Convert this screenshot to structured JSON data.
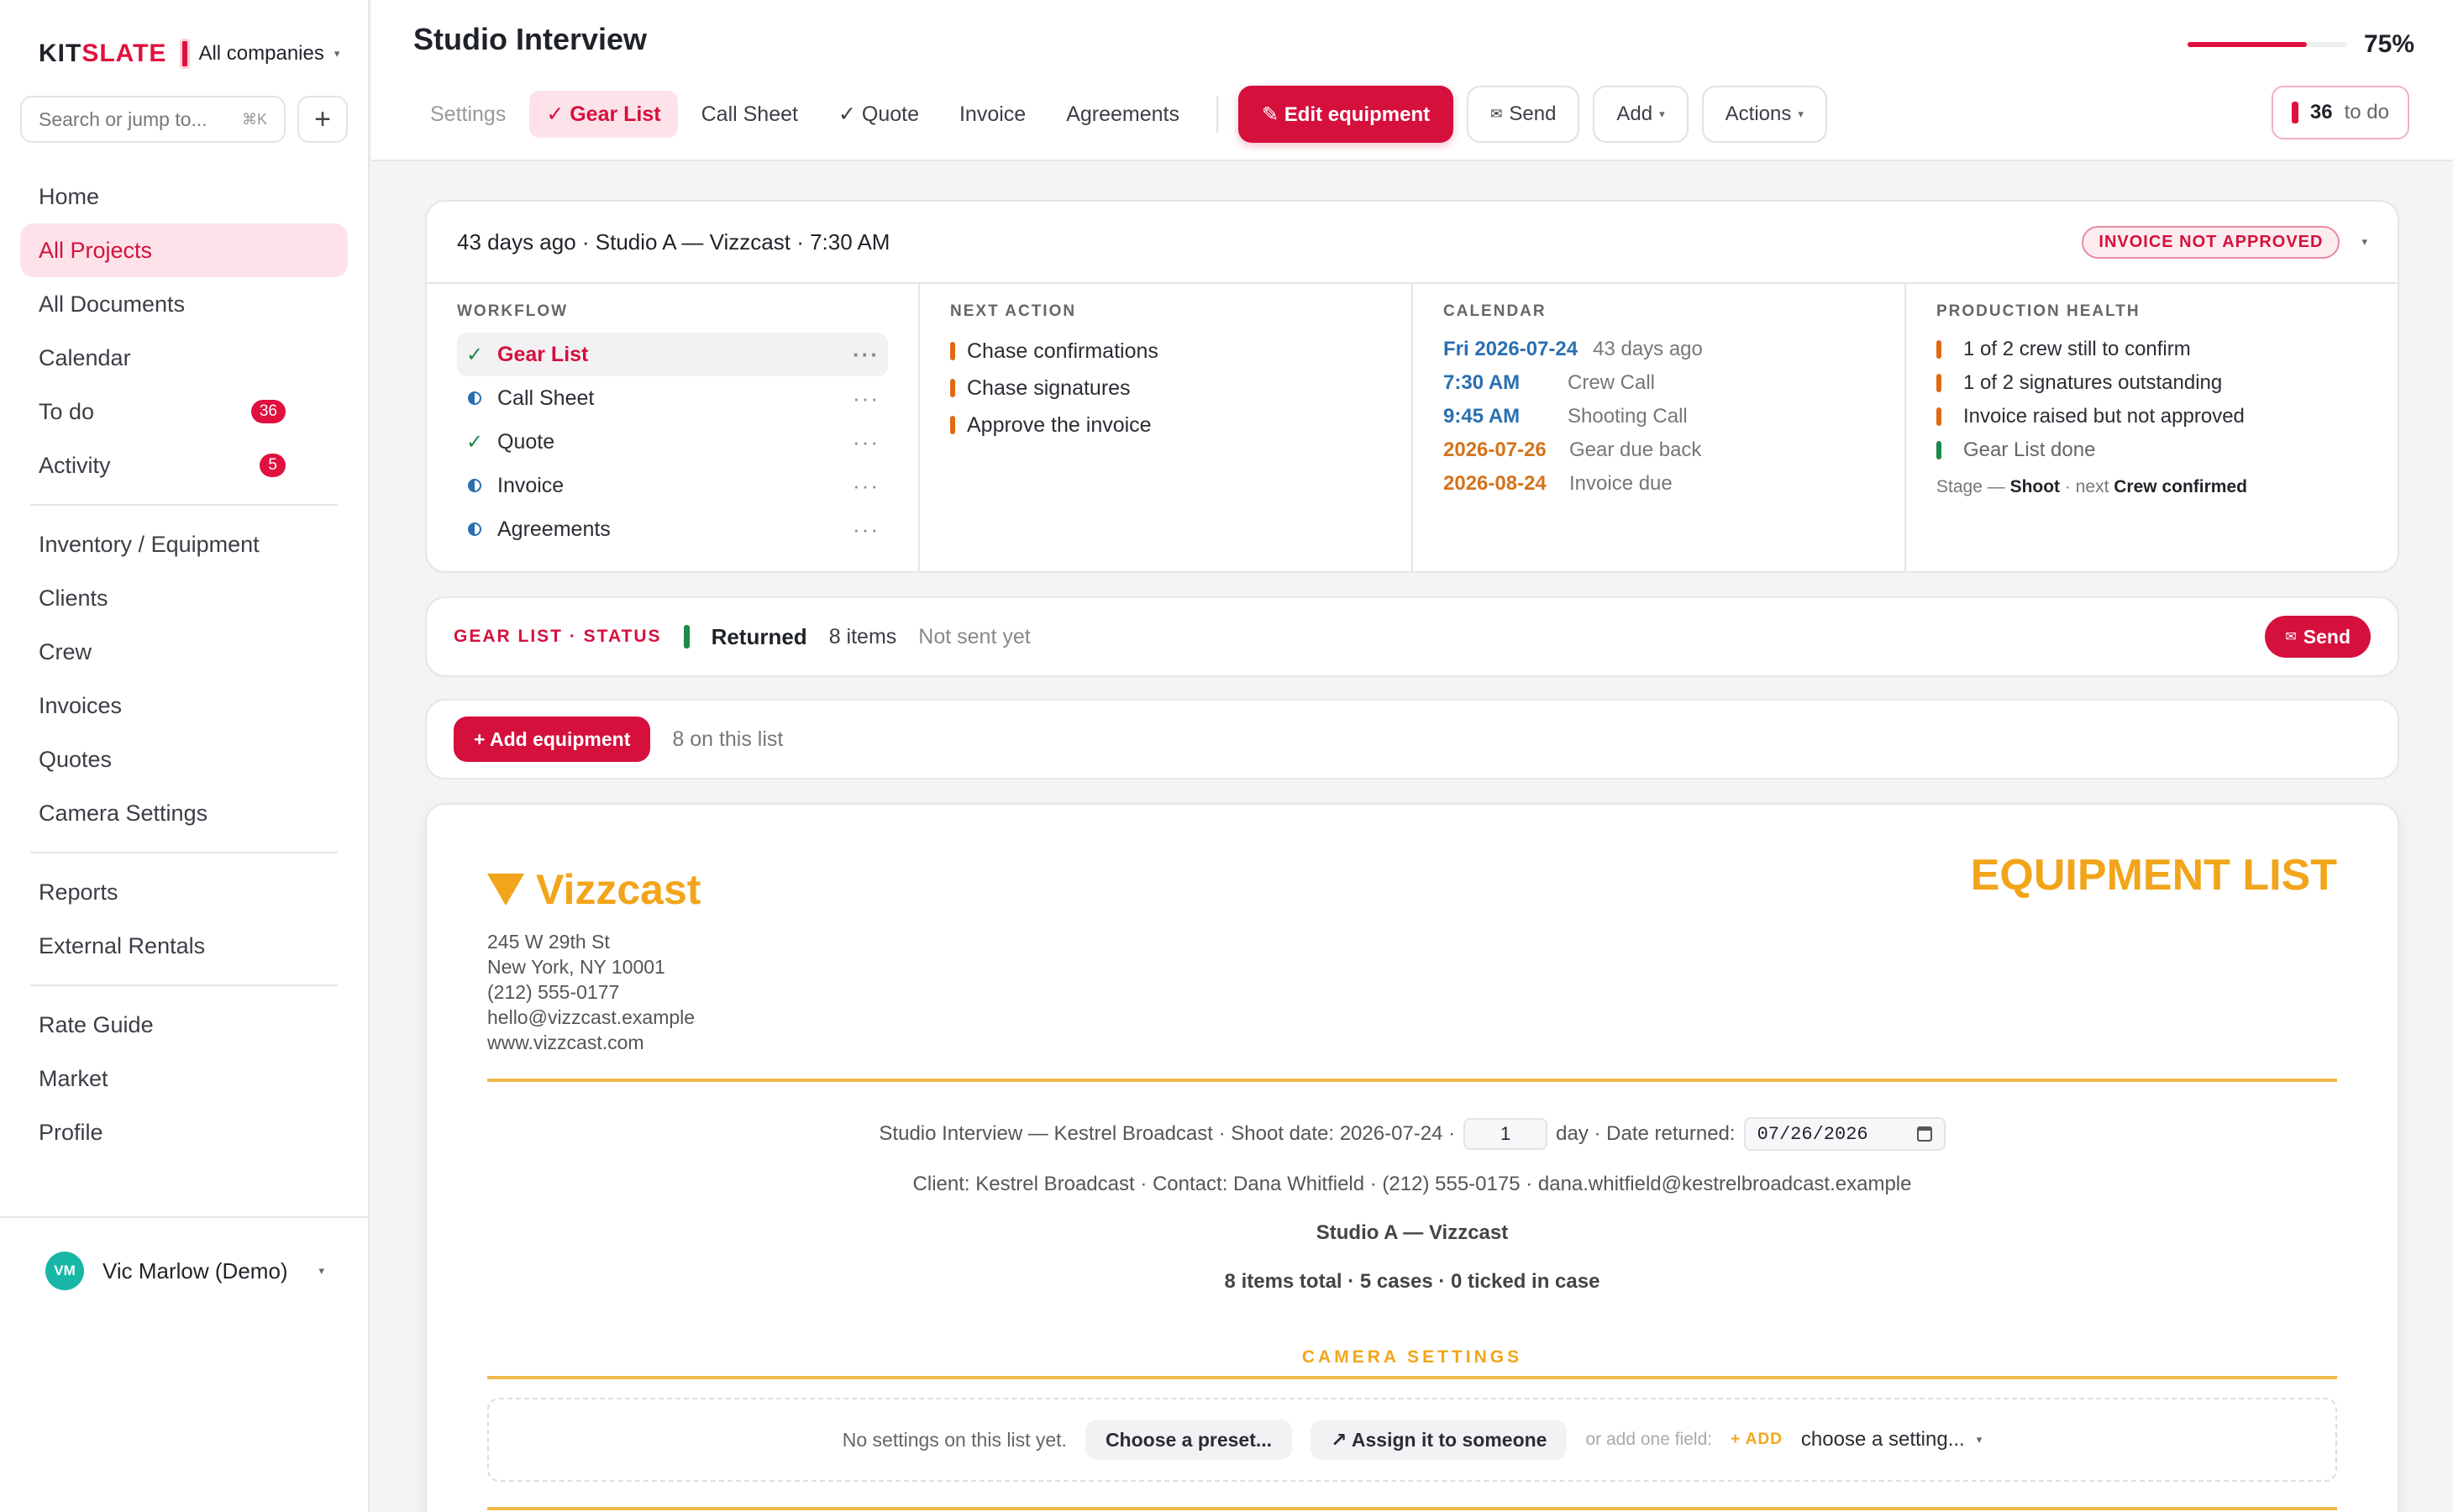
{
  "app": {
    "brand_left": "KIT",
    "brand_right": "SLATE",
    "company": "All companies"
  },
  "search": {
    "placeholder": "Search or jump to...",
    "shortcut": "⌘K"
  },
  "nav": {
    "group1": [
      {
        "label": "Home"
      },
      {
        "label": "All Projects",
        "active": true
      },
      {
        "label": "All Documents"
      },
      {
        "label": "Calendar"
      },
      {
        "label": "To do",
        "badge": "36"
      },
      {
        "label": "Activity",
        "badge": "5"
      }
    ],
    "group2": [
      {
        "label": "Inventory / Equipment"
      },
      {
        "label": "Clients"
      },
      {
        "label": "Crew"
      },
      {
        "label": "Invoices"
      },
      {
        "label": "Quotes"
      },
      {
        "label": "Camera Settings"
      }
    ],
    "group3": [
      {
        "label": "Reports"
      },
      {
        "label": "External Rentals"
      }
    ],
    "group4": [
      {
        "label": "Rate Guide"
      },
      {
        "label": "Market"
      },
      {
        "label": "Profile"
      }
    ]
  },
  "user": {
    "initials": "VM",
    "name": "Vic Marlow (Demo)"
  },
  "header": {
    "title": "Studio Interview",
    "tabs": [
      {
        "label": "Settings"
      },
      {
        "label": "✓ Gear List"
      },
      {
        "label": "Call Sheet"
      },
      {
        "label": "✓ Quote"
      },
      {
        "label": "Invoice"
      },
      {
        "label": "Agreements"
      }
    ],
    "edit_label": "✎ Edit equipment",
    "send_label": "Send",
    "add_label": "Add",
    "actions_label": "Actions",
    "progress_value": 75,
    "progress_text": "75%",
    "todo_count": "36",
    "todo_label": "to do"
  },
  "summary": {
    "title": "43 days ago · Studio A — Vizzcast · 7:30 AM",
    "status_pill": "INVOICE NOT APPROVED",
    "workflow_heading": "WORKFLOW",
    "workflow": [
      {
        "label": "Gear List",
        "state": "done"
      },
      {
        "label": "Call Sheet",
        "state": "partial"
      },
      {
        "label": "Quote",
        "state": "done"
      },
      {
        "label": "Invoice",
        "state": "partial"
      },
      {
        "label": "Agreements",
        "state": "partial"
      }
    ],
    "next_heading": "NEXT ACTION",
    "next_actions": [
      "Chase confirmations",
      "Chase signatures",
      "Approve the invoice"
    ],
    "calendar_heading": "CALENDAR",
    "calendar": [
      {
        "key": "Fri 2026-07-24",
        "value": "43 days ago",
        "tone": "blue"
      },
      {
        "key": "7:30 AM",
        "value": "Crew Call",
        "tone": "blue"
      },
      {
        "key": "9:45 AM",
        "value": "Shooting Call",
        "tone": "blue"
      },
      {
        "key": "2026-07-26",
        "value": "Gear due back",
        "tone": "orange"
      },
      {
        "key": "2026-08-24",
        "value": "Invoice due",
        "tone": "orange"
      }
    ],
    "health_heading": "PRODUCTION HEALTH",
    "health": [
      {
        "label": "1 of 2 crew still to confirm",
        "tone": "orange"
      },
      {
        "label": "1 of 2 signatures outstanding",
        "tone": "orange"
      },
      {
        "label": "Invoice raised but not approved",
        "tone": "orange"
      },
      {
        "label": "Gear List done",
        "tone": "green"
      }
    ],
    "stage_prefix": "Stage —",
    "stage_value": "Shoot",
    "stage_mid": "· next",
    "stage_next": "Crew confirmed"
  },
  "gear_status": {
    "label": "GEAR LIST · STATUS",
    "status": "Returned",
    "items": "8 items",
    "note": "Not sent yet",
    "send_label": "Send"
  },
  "add_bar": {
    "button_label": "+ Add equipment",
    "note": "8 on this list"
  },
  "doc": {
    "brand": "Vizzcast",
    "address": [
      "245 W 29th St",
      "New York, NY 10001",
      "(212) 555-0177",
      "hello@vizzcast.example",
      "www.vizzcast.com"
    ],
    "title": "EQUIPMENT LIST",
    "line1_prefix": "Studio Interview — Kestrel Broadcast · Shoot date: 2026-07-24 ·",
    "days_value": "1",
    "line1_mid": "day · Date returned:",
    "date_returned": "07/26/2026",
    "line2": "Client: Kestrel Broadcast · Contact: Dana Whitfield · (212) 555-0175 · dana.whitfield@kestrelbroadcast.example",
    "line3": "Studio A — Vizzcast",
    "line4": "8 items total · 5 cases · 0 ticked in case",
    "section": "CAMERA SETTINGS",
    "settings_note": "No settings on this list yet.",
    "preset_label": "Choose a preset...",
    "assign_label": "↗ Assign it to someone",
    "or_add": "or add one field:",
    "add_small": "+ ADD",
    "select_value": "choose a setting..."
  },
  "colors": {
    "accent": "#d5103d",
    "brand_orange": "#f2a51a",
    "ok_green": "#1c8a4a",
    "warn_orange": "#e06a14",
    "info_blue": "#2a6fb0"
  }
}
